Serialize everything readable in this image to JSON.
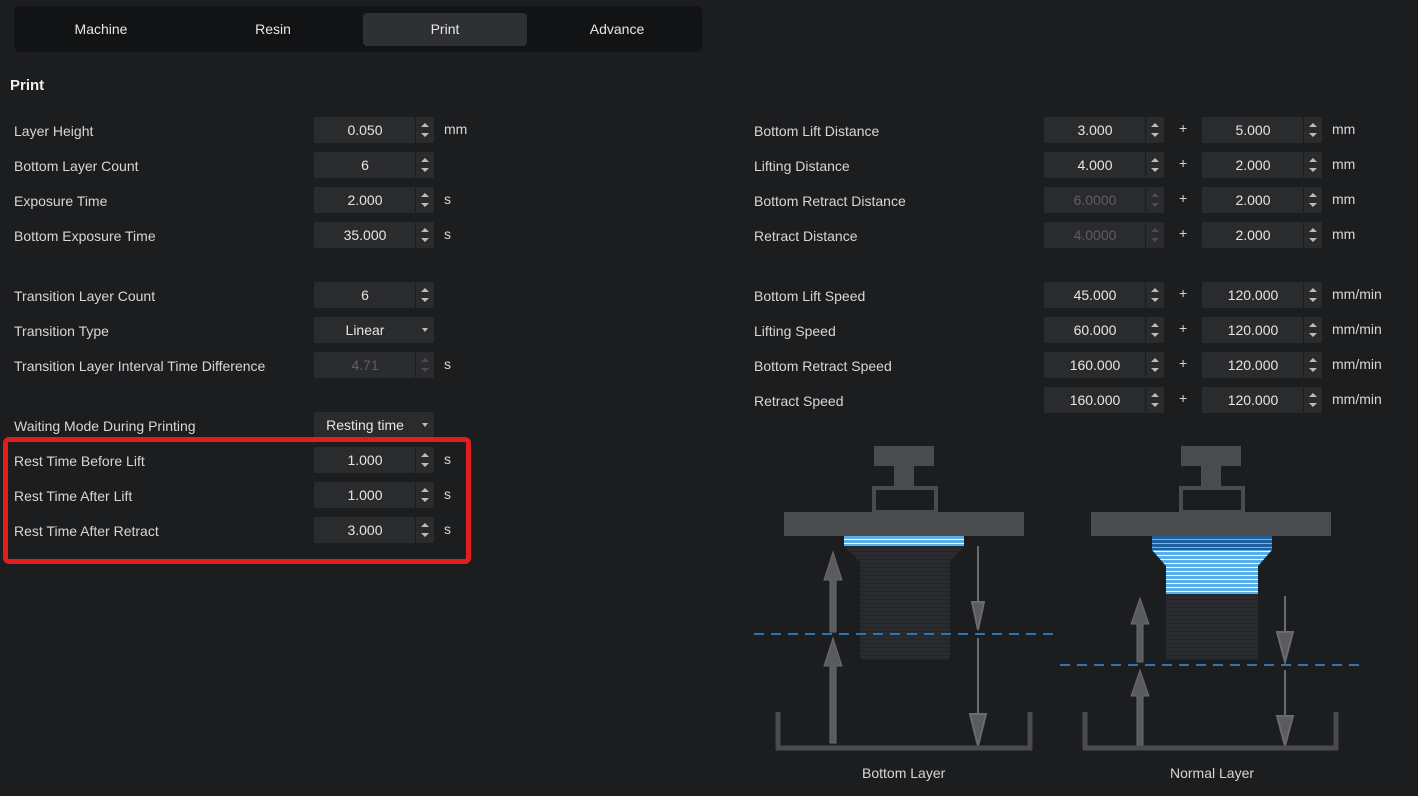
{
  "tabs": [
    {
      "label": "Machine",
      "active": false
    },
    {
      "label": "Resin",
      "active": false
    },
    {
      "label": "Print",
      "active": true
    },
    {
      "label": "Advance",
      "active": false
    }
  ],
  "section_title": "Print",
  "left": {
    "layer_height": {
      "label": "Layer Height",
      "value": "0.050",
      "unit": "mm"
    },
    "bottom_layer_count": {
      "label": "Bottom Layer Count",
      "value": "6"
    },
    "exposure_time": {
      "label": "Exposure Time",
      "value": "2.000",
      "unit": "s"
    },
    "bottom_exposure_time": {
      "label": "Bottom Exposure Time",
      "value": "35.000",
      "unit": "s"
    },
    "transition_layer_count": {
      "label": "Transition Layer Count",
      "value": "6"
    },
    "transition_type": {
      "label": "Transition Type",
      "value": "Linear"
    },
    "transition_interval": {
      "label": "Transition Layer Interval Time Difference",
      "value": "4.71",
      "unit": "s"
    },
    "waiting_mode": {
      "label": "Waiting Mode During Printing",
      "value": "Resting time"
    },
    "rest_before_lift": {
      "label": "Rest Time Before Lift",
      "value": "1.000",
      "unit": "s"
    },
    "rest_after_lift": {
      "label": "Rest Time After Lift",
      "value": "1.000",
      "unit": "s"
    },
    "rest_after_retract": {
      "label": "Rest Time After Retract",
      "value": "3.000",
      "unit": "s"
    }
  },
  "right": {
    "plus": "+",
    "bottom_lift_distance": {
      "label": "Bottom Lift Distance",
      "value1": "3.000",
      "value2": "5.000",
      "unit": "mm"
    },
    "lifting_distance": {
      "label": "Lifting Distance",
      "value1": "4.000",
      "value2": "2.000",
      "unit": "mm"
    },
    "bottom_retract_distance": {
      "label": "Bottom Retract Distance",
      "value1": "6.0000",
      "value2": "2.000",
      "unit": "mm"
    },
    "retract_distance": {
      "label": "Retract Distance",
      "value1": "4.0000",
      "value2": "2.000",
      "unit": "mm"
    },
    "bottom_lift_speed": {
      "label": "Bottom Lift Speed",
      "value1": "45.000",
      "value2": "120.000",
      "unit": "mm/min"
    },
    "lifting_speed": {
      "label": "Lifting Speed",
      "value1": "60.000",
      "value2": "120.000",
      "unit": "mm/min"
    },
    "bottom_retract_speed": {
      "label": "Bottom Retract Speed",
      "value1": "160.000",
      "value2": "120.000",
      "unit": "mm/min"
    },
    "retract_speed": {
      "label": "Retract Speed",
      "value1": "160.000",
      "value2": "120.000",
      "unit": "mm/min"
    }
  },
  "diagrams": {
    "bottom_label": "Bottom Layer",
    "normal_label": "Normal Layer"
  },
  "colors": {
    "highlight": "#e21d1f",
    "layer_light": "#5aaee8",
    "layer_dark": "#1f5fa0",
    "dashed_line": "#2f73b5"
  }
}
